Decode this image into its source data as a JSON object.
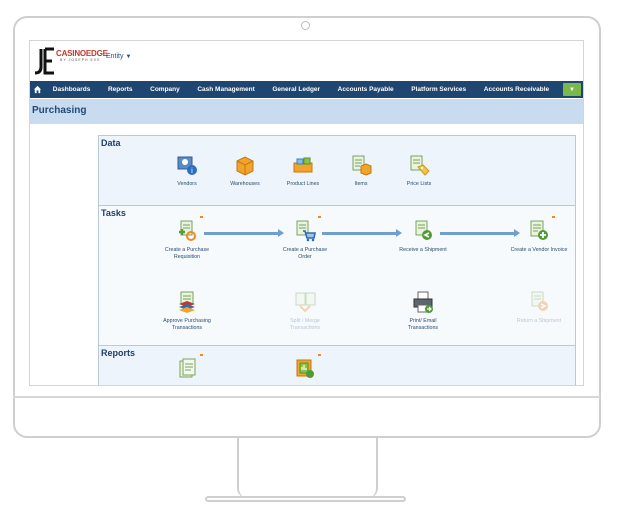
{
  "app": {
    "brand": "CASINOEDGE",
    "brand_sub": "BY JOSEPH EVE",
    "entity_label": "Entity"
  },
  "nav": {
    "items": [
      "Dashboards",
      "Reports",
      "Company",
      "Cash Management",
      "General Ledger",
      "Accounts Payable",
      "Platform Services",
      "Accounts Receivable"
    ],
    "more_icon": "chevron-down-icon"
  },
  "page": {
    "title": "Purchasing"
  },
  "sections": {
    "data": "Data",
    "tasks": "Tasks",
    "reports": "Reports"
  },
  "data_tiles": [
    "Vendors",
    "Warehouses",
    "Product Lines",
    "Items",
    "Price Lists"
  ],
  "task_flow": [
    [
      "Create a Purchase",
      "Requisition"
    ],
    [
      "Create a Purchase",
      "Order"
    ],
    [
      "Receive a Shipment",
      ""
    ],
    [
      "Create a Vendor Invoice",
      ""
    ]
  ],
  "task_other": [
    [
      "Approve Purchasing",
      "Transactions"
    ],
    [
      "Split / Merge",
      "Transactions"
    ],
    [
      "Print/ Email",
      "Transactions"
    ],
    [
      "Return a Shipment",
      ""
    ]
  ],
  "colors": {
    "nav_bg": "#1f4670",
    "pagehead_bg": "#c8dbef",
    "accent_green": "#7bb84b",
    "accent_orange": "#f08a24"
  }
}
